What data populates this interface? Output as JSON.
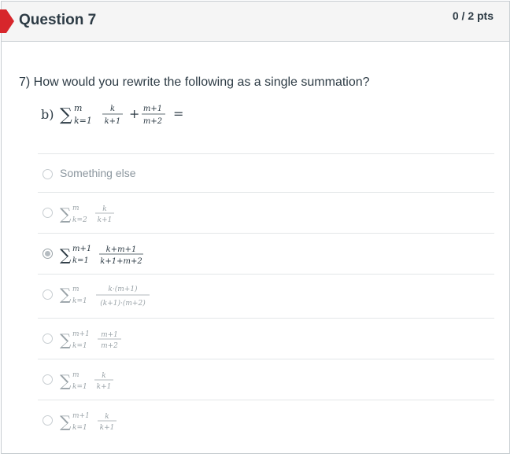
{
  "question": {
    "title": "Question 7",
    "points": "0 / 2 pts",
    "prompt": "7) How would you rewrite the following as a single summation?",
    "expr": {
      "label": "b)",
      "sigma": "∑",
      "upper": "m",
      "lower": "k=1",
      "frac1_num": "k",
      "frac1_den": "k+1",
      "plus": "+",
      "frac2_num": "m+1",
      "frac2_den": "m+2",
      "equals": "="
    }
  },
  "answers": [
    {
      "text": "Something else",
      "selected": false
    },
    {
      "sigma": "∑",
      "upper": "m",
      "lower": "k=2",
      "num": "k",
      "den": "k+1",
      "selected": false
    },
    {
      "sigma": "∑",
      "upper": "m+1",
      "lower": "k=1",
      "num": "k+m+1",
      "den": "k+1+m+2",
      "selected": true
    },
    {
      "sigma": "∑",
      "upper": "m",
      "lower": "k=1",
      "num": "k·(m+1)",
      "den": "(k+1)·(m+2)",
      "selected": false
    },
    {
      "sigma": "∑",
      "upper": "m+1",
      "lower": "k=1",
      "num": "m+1",
      "den": "m+2",
      "selected": false
    },
    {
      "sigma": "∑",
      "upper": "m",
      "lower": "k=1",
      "num": "k",
      "den": "k+1",
      "selected": false
    },
    {
      "sigma": "∑",
      "upper": "m+1",
      "lower": "k=1",
      "num": "k",
      "den": "k+1",
      "selected": false
    }
  ],
  "colors": {
    "flag": "#d7262b",
    "header_bg": "#f5f5f5",
    "border": "#c7cdd1"
  }
}
